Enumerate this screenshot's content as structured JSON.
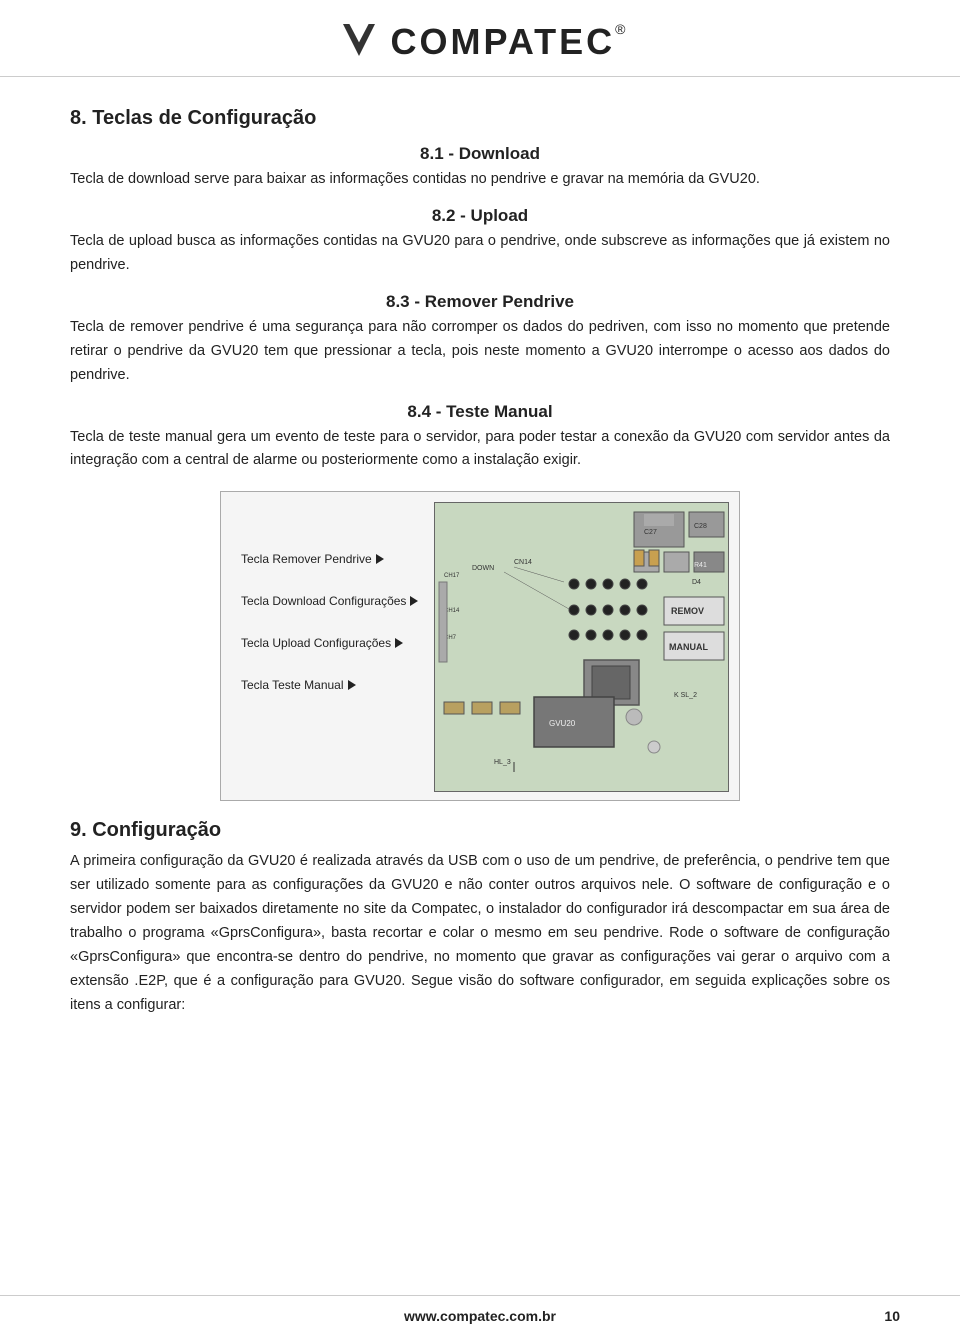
{
  "header": {
    "logo_text": "COMPATEC",
    "logo_reg": "®"
  },
  "sections": {
    "main_title": "8. Teclas de Configuração",
    "s81": {
      "title": "8.1 - Download",
      "body": "Tecla de download serve para baixar as informações contidas no pendrive e gravar na memória da GVU20."
    },
    "s82": {
      "title": "8.2 - Upload",
      "body": "Tecla de upload busca as informações contidas na GVU20 para o pendrive, onde subscreve as informações que já existem no pendrive."
    },
    "s83": {
      "title": "8.3 - Remover Pendrive",
      "body": "Tecla de remover pendrive é uma segurança para não corromper os dados do pedriven,  com isso no momento que pretende retirar o pendrive da GVU20 tem que pressionar a tecla, pois neste momento a GVU20 interrompe o acesso aos dados do pendrive."
    },
    "s84": {
      "title": "8.4 - Teste Manual",
      "body": "Tecla de teste manual gera um evento de teste para o servidor, para poder testar a conexão da GVU20 com servidor antes da integração com a central de alarme ou posteriormente como a instalação exigir."
    },
    "diagram": {
      "label1": "Tecla Remover Pendrive",
      "label2": "Tecla Download Configurações",
      "label3": "Tecla Upload Configurações",
      "label4": "Tecla Teste Manual"
    },
    "s9": {
      "title": "9. Configuração",
      "body1": "A primeira configuração da GVU20 é realizada através da USB com o uso de um pendrive, de preferência, o pendrive tem que ser utilizado somente para as configurações da GVU20 e não conter outros arquivos nele. O software de configuração e o servidor podem ser baixados diretamente no site da Compatec, o instalador do configurador irá descompactar em sua área de trabalho o programa «GprsConfigura», basta recortar e colar o mesmo em seu pendrive. Rode o software de configuração «GprsConfigura» que encontra-se dentro do pendrive, no momento que gravar as configurações vai gerar o arquivo com a extensão .E2P,  que é a configuração para GVU20. Segue visão do software configurador, em seguida explicações sobre os itens a configurar:"
    }
  },
  "footer": {
    "url": "www.compatec.com.br",
    "page": "10"
  }
}
